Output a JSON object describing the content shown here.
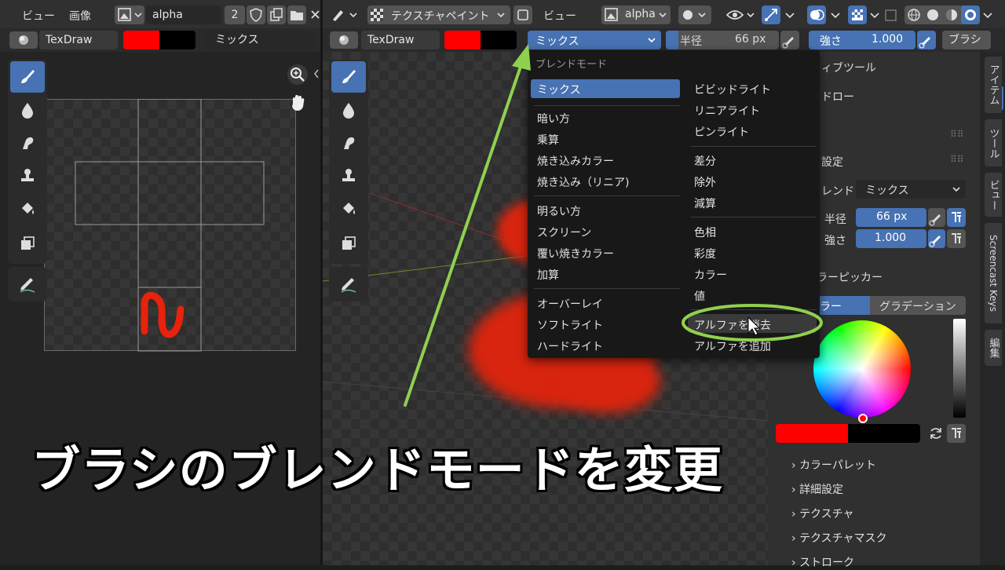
{
  "left_editor": {
    "menu": [
      "ビュー",
      "画像"
    ],
    "image_name": "alpha",
    "user_count": "2",
    "brush_name": "TexDraw",
    "blend_value": "ミックス"
  },
  "viewport": {
    "mode": "テクスチャペイント",
    "menu_view": "ビュー",
    "image_name": "alpha",
    "brush_name": "TexDraw",
    "blend_value": "ミックス",
    "radius_label": "半径",
    "radius_value": "66 px",
    "strength_label": "強さ",
    "strength_value": "1.000",
    "brush_menu": "ブラシ"
  },
  "blend_menu": {
    "title": "ブレンドモード",
    "left_groups": [
      [
        "ミックス"
      ],
      [
        "暗い方",
        "乗算",
        "焼き込みカラー",
        "焼き込み（リニア)"
      ],
      [
        "明るい方",
        "スクリーン",
        "覆い焼きカラー",
        "加算"
      ],
      [
        "オーバーレイ",
        "ソフトライト",
        "ハードライト"
      ]
    ],
    "right_groups": [
      [
        "ビビッドライト",
        "リニアライト",
        "ピンライト"
      ],
      [
        "差分",
        "除外",
        "減算"
      ],
      [
        "色相",
        "彩度",
        "カラー",
        "値"
      ],
      [
        "アルファを消去",
        "アルファを追加"
      ]
    ],
    "selected": "ミックス",
    "hovered": "アルファを消去"
  },
  "sidebar": {
    "tabs": [
      "アイテム",
      "ツール",
      "ビュー",
      "Screencast Keys",
      "編集"
    ],
    "active_tool_label": "ィブツール",
    "active_tool_name": "ドロー",
    "brush_settings_label": "設定",
    "blend_label": "レンド",
    "blend_value": "ミックス",
    "radius_label": "半径",
    "radius_value": "66 px",
    "strength_label": "強さ",
    "strength_value": "1.000",
    "color_picker_label": "ラーピッカー",
    "color_tab": "ラー",
    "gradient_tab": "グラデーション",
    "sections": [
      "カラーパレット",
      "詳細設定",
      "テクスチャ",
      "テクスチャマスク",
      "ストローク"
    ]
  },
  "caption": "ブラシのブレンドモードを変更",
  "colors": {
    "accent": "#4772b3",
    "brush_color": "#ff0000",
    "highlight_ring": "#8fd14f",
    "paint": "#e8220c"
  }
}
